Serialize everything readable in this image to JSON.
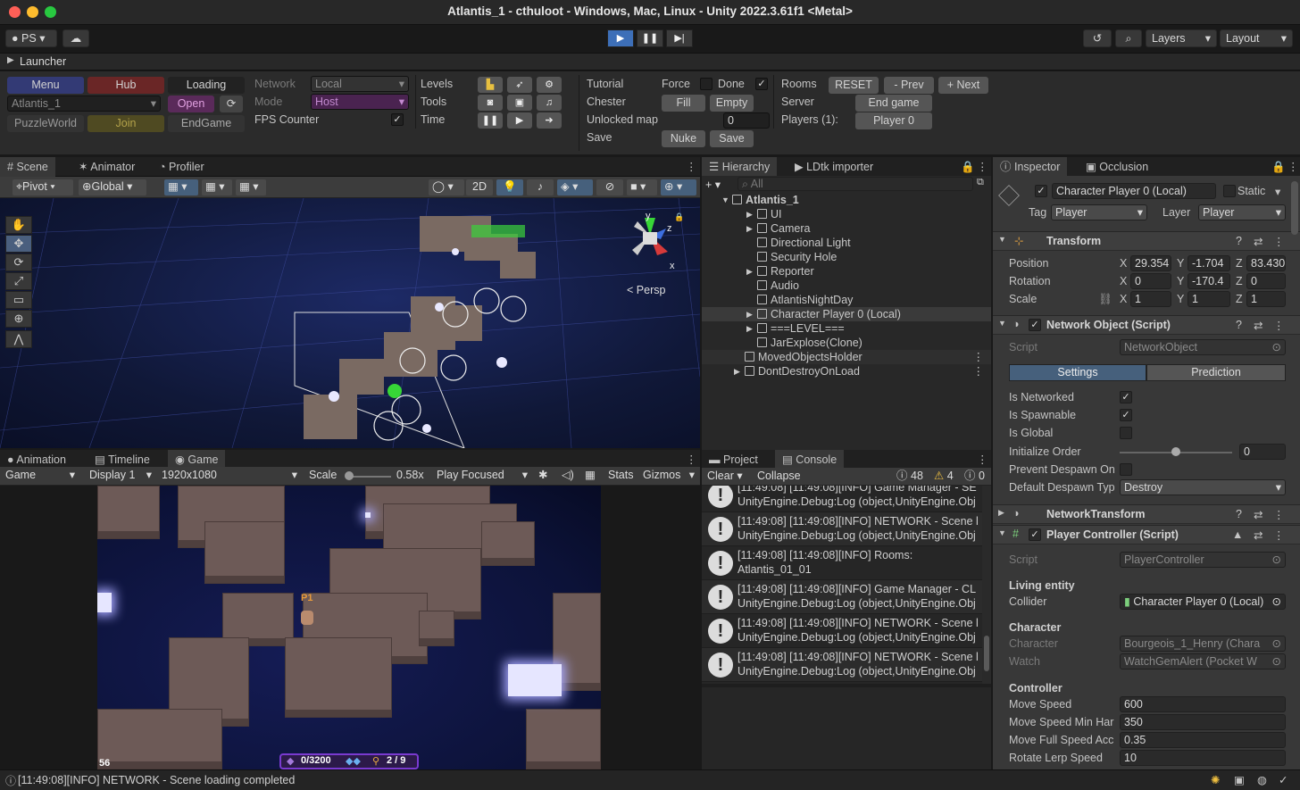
{
  "window": {
    "title": "Atlantis_1 - cthuloot - Windows, Mac, Linux - Unity 2022.3.61f1 <Metal>"
  },
  "toolbar": {
    "account": "PS",
    "layers": "Layers",
    "layout": "Layout"
  },
  "launcher": {
    "title": "Launcher",
    "menu": "Menu",
    "hub": "Hub",
    "loading": "Loading",
    "scene_select": "Atlantis_1",
    "open": "Open",
    "puzzleworld": "PuzzleWorld",
    "join": "Join",
    "endgame": "EndGame",
    "network_label": "Network",
    "network_value": "Local",
    "mode_label": "Mode",
    "mode_value": "Host",
    "fps_label": "FPS Counter",
    "levels": "Levels",
    "tools": "Tools",
    "time": "Time",
    "tutorial": "Tutorial",
    "force": "Force",
    "done": "Done",
    "chester": "Chester",
    "fill": "Fill",
    "empty": "Empty",
    "unlocked_map": "Unlocked map",
    "unlocked_value": "0",
    "save_label": "Save",
    "nuke": "Nuke",
    "save_btn": "Save",
    "rooms": "Rooms",
    "reset": "RESET",
    "prev": "- Prev",
    "next": "+ Next",
    "server": "Server",
    "end_game": "End game",
    "players": "Players (1):",
    "player0": "Player 0"
  },
  "scene_tabs": {
    "scene": "Scene",
    "animator": "Animator",
    "profiler": "Profiler"
  },
  "scene_toolbar": {
    "pivot": "Pivot",
    "global": "Global",
    "mode2d": "2D"
  },
  "gizmo": {
    "y": "y",
    "z": "z",
    "x": "x",
    "persp": "Persp"
  },
  "game_tabs": {
    "animation": "Animation",
    "timeline": "Timeline",
    "game": "Game"
  },
  "game_toolbar": {
    "game": "Game",
    "display": "Display 1",
    "resolution": "1920x1080",
    "scale_label": "Scale",
    "scale_value": "0.58x",
    "play_focused": "Play Focused",
    "stats": "Stats",
    "gizmos": "Gizmos"
  },
  "game_hud": {
    "fps": "56",
    "gems": "0/3200",
    "keys": "2 / 9",
    "player_tag": "P1"
  },
  "hierarchy": {
    "tab": "Hierarchy",
    "tab2": "LDtk importer",
    "search": "All",
    "rows": [
      {
        "label": "Atlantis_1"
      },
      {
        "label": "UI"
      },
      {
        "label": "Camera"
      },
      {
        "label": "Directional Light"
      },
      {
        "label": "Security Hole"
      },
      {
        "label": "Reporter"
      },
      {
        "label": "Audio"
      },
      {
        "label": "AtlantisNightDay"
      },
      {
        "label": "Character Player 0 (Local)"
      },
      {
        "label": "===LEVEL==="
      },
      {
        "label": "JarExplose(Clone)"
      },
      {
        "label": "MovedObjectsHolder"
      },
      {
        "label": "DontDestroyOnLoad"
      }
    ]
  },
  "console": {
    "tab_project": "Project",
    "tab_console": "Console",
    "clear": "Clear",
    "collapse": "Collapse",
    "count_info": "48",
    "count_warn": "4",
    "count_err": "0",
    "partial_top": "[11:49:08] [11:49:08][INFO] Game Manager - SE",
    "rows": [
      {
        "l1": "[11:49:08] [11:49:08][INFO] Game Manager - SE",
        "l2": "UnityEngine.Debug:Log (object,UnityEngine.Obj"
      },
      {
        "l1": "[11:49:08] [11:49:08][INFO] NETWORK - Scene l",
        "l2": "UnityEngine.Debug:Log (object,UnityEngine.Obj"
      },
      {
        "l1": "[11:49:08] [11:49:08][INFO] Rooms:",
        "l2": "Atlantis_01_01"
      },
      {
        "l1": "[11:49:08] [11:49:08][INFO] Game Manager - CL",
        "l2": "UnityEngine.Debug:Log (object,UnityEngine.Obj"
      },
      {
        "l1": "[11:49:08] [11:49:08][INFO] NETWORK - Scene l",
        "l2": "UnityEngine.Debug:Log (object,UnityEngine.Obj"
      },
      {
        "l1": "[11:49:08] [11:49:08][INFO] NETWORK - Scene l",
        "l2": "UnityEngine.Debug:Log (object,UnityEngine.Obj"
      }
    ]
  },
  "inspector": {
    "tab": "Inspector",
    "tab2": "Occlusion",
    "object_name": "Character Player 0 (Local)",
    "static": "Static",
    "tag_label": "Tag",
    "tag_value": "Player",
    "layer_label": "Layer",
    "layer_value": "Player",
    "transform": "Transform",
    "position": "Position",
    "pos_x": "29.354",
    "pos_y": "-1.704",
    "pos_z": "83.430",
    "rotation": "Rotation",
    "rot_x": "0",
    "rot_y": "-170.4",
    "rot_z": "0",
    "scale": "Scale",
    "scl_x": "1",
    "scl_y": "1",
    "scl_z": "1",
    "x": "X",
    "y": "Y",
    "z": "Z",
    "network_object": "Network Object (Script)",
    "script_label": "Script",
    "network_object_script": "NetworkObject",
    "settings": "Settings",
    "prediction": "Prediction",
    "is_networked": "Is Networked",
    "is_spawnable": "Is Spawnable",
    "is_global": "Is Global",
    "initialize_order": "Initialize Order",
    "initialize_value": "0",
    "prevent_despawn": "Prevent Despawn On",
    "default_despawn": "Default Despawn Typ",
    "default_despawn_value": "Destroy",
    "network_transform": "NetworkTransform",
    "player_controller": "Player Controller (Script)",
    "player_controller_script": "PlayerController",
    "living_entity": "Living entity",
    "collider": "Collider",
    "collider_value": "Character Player 0 (Local)",
    "character_header": "Character",
    "character": "Character",
    "character_value": "Bourgeois_1_Henry (Chara",
    "watch": "Watch",
    "watch_value": "WatchGemAlert (Pocket W",
    "controller": "Controller",
    "move_speed": "Move Speed",
    "move_speed_value": "600",
    "move_speed_min": "Move Speed Min Har",
    "move_speed_min_value": "350",
    "move_full": "Move Full Speed Acc",
    "move_full_value": "0.35",
    "rotate_lerp": "Rotate Lerp Speed",
    "rotate_lerp_value": "10"
  },
  "status": {
    "message": "[11:49:08][INFO] NETWORK - Scene loading completed"
  },
  "colors": {
    "accent": "#3d6fb8",
    "menu": "#3a3f7a",
    "hub": "#6b2a2a",
    "open": "#5a2a5a",
    "join": "#5a5020",
    "host": "#4a2350"
  }
}
